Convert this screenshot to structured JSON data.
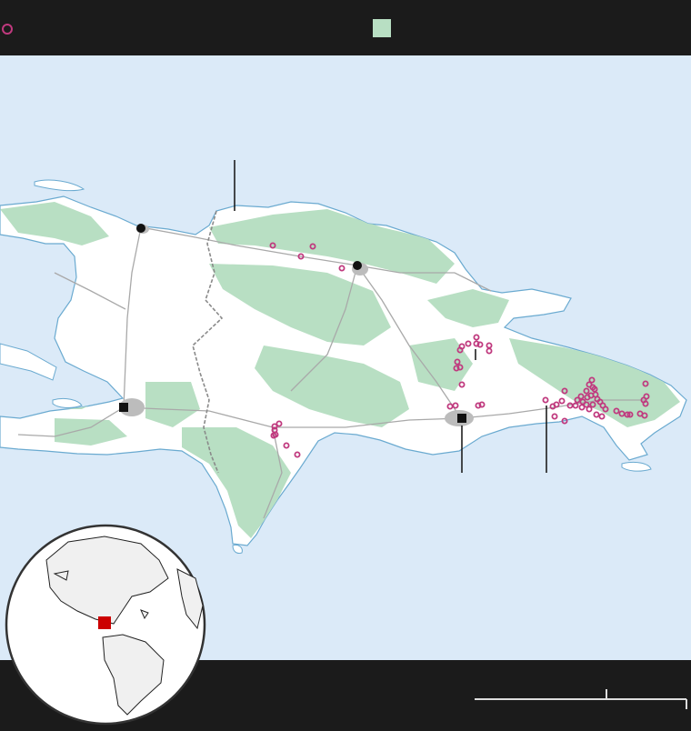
{
  "map": {
    "region": "Hispaniola",
    "colors": {
      "water": "#dbeaf8",
      "land": "#ffffff",
      "forest": "#b8dfc3",
      "coast": "#6aaad0",
      "roads": "#a9a9a9",
      "markers": "#c0397e",
      "bars": "#1b1b1b",
      "globe_highlight": "#cc0000"
    },
    "legend": {
      "circle_icon": "open-circle-icon",
      "forest_icon": "green-square-icon"
    },
    "capitals_count": 2,
    "cities_count": 2,
    "site_marker_count": 86
  }
}
